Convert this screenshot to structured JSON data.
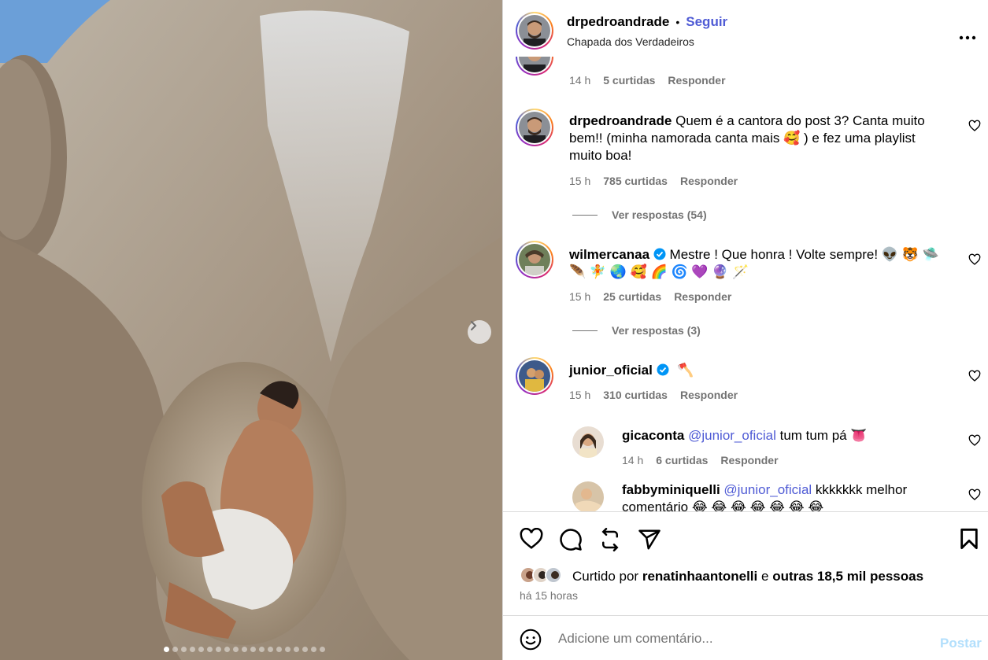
{
  "post": {
    "username": "drpedroandrade",
    "separator": "•",
    "follow_label": "Seguir",
    "location": "Chapada dos Verdadeiros",
    "carousel_total": 19,
    "carousel_active_index": 0
  },
  "comments": [
    {
      "time": "14 h",
      "likes": "5 curtidas",
      "reply": "Responder"
    },
    {
      "username": "drpedroandrade",
      "text_line1": "Quem é a cantora do post 3? Canta muito",
      "text_line2": "bem!! (minha namorada canta mais 🥰 ) e fez uma playlist",
      "text_line3": "muito boa!",
      "time": "15 h",
      "likes": "785 curtidas",
      "reply": "Responder",
      "view_replies": "Ver respostas (54)"
    },
    {
      "username": "wilmercanaa",
      "text_line1": "Mestre ! Que honra ! Volte sempre! 👽 🐯 🛸",
      "text_line2": "🪶 🧚 🌏 🥰 🌈 🌀 💜 🔮 🪄",
      "time": "15 h",
      "likes": "25 curtidas",
      "reply": "Responder",
      "view_replies": "Ver respostas (3)"
    },
    {
      "username": "junior_oficial",
      "text_line1": "🪓",
      "time": "15 h",
      "likes": "310 curtidas",
      "reply": "Responder"
    }
  ],
  "replies": [
    {
      "username": "gicaconta",
      "mention": "@junior_oficial",
      "text": "tum tum pá 👅",
      "time": "14 h",
      "likes": "6 curtidas",
      "reply": "Responder"
    },
    {
      "username": "fabbyminiquelli",
      "mention": "@junior_oficial",
      "text_line1": "kkkkkkk melhor",
      "text_line2": "comentário 😂 😂 😂 😂 😂 😂 😂"
    }
  ],
  "likes_bar": {
    "prefix": "Curtido por",
    "liker": "renatinhaantonelli",
    "connector": "e",
    "others": "outras 18,5 mil pessoas",
    "posted": "há 15 horas"
  },
  "comment_input": {
    "placeholder": "Adicione um comentário...",
    "post_label": "Postar"
  },
  "colors": {
    "link": "#4f5bd5",
    "muted": "#737373",
    "post_disabled": "#b2dffc"
  },
  "icons": [
    "more-options-icon",
    "chevron-right-icon",
    "heart-icon",
    "comment-icon",
    "share-icon",
    "send-icon",
    "bookmark-icon",
    "emoji-icon",
    "verified-icon"
  ]
}
